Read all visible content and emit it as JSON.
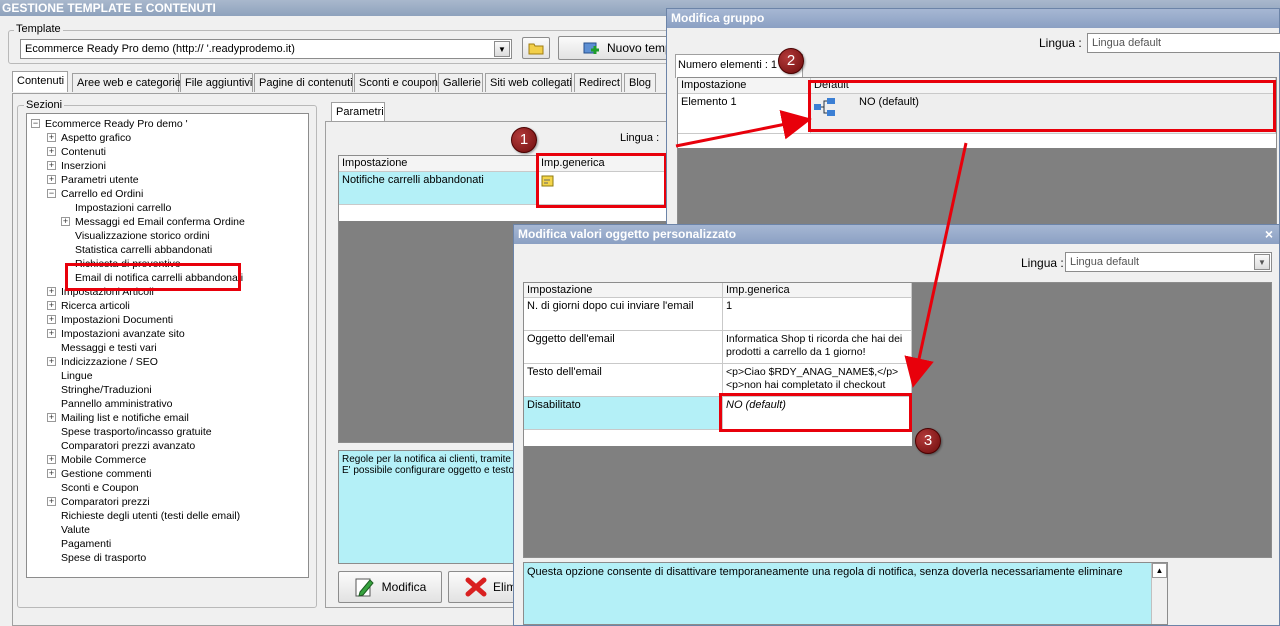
{
  "app": {
    "title": "GESTIONE TEMPLATE E CONTENUTI"
  },
  "template": {
    "legend": "Template",
    "selected": "Ecommerce Ready Pro demo        (http://         '.readyprodemo.it)",
    "new_button": "Nuovo temp"
  },
  "tabs": [
    "Contenuti",
    "Aree web e categorie",
    "File aggiuntivi",
    "Pagine di contenuti",
    "Sconti e coupon",
    "Gallerie",
    "Siti web collegati",
    "Redirect",
    "Blog"
  ],
  "sections": {
    "legend": "Sezioni",
    "root": "Ecommerce Ready Pro demo         '",
    "items": [
      {
        "label": "Aspetto grafico",
        "level": 1,
        "exp": "+"
      },
      {
        "label": "Contenuti",
        "level": 1,
        "exp": "+"
      },
      {
        "label": "Inserzioni",
        "level": 1,
        "exp": "+"
      },
      {
        "label": "Parametri utente",
        "level": 1,
        "exp": "+"
      },
      {
        "label": "Carrello ed Ordini",
        "level": 1,
        "exp": "-"
      },
      {
        "label": "Impostazioni carrello",
        "level": 2,
        "exp": ""
      },
      {
        "label": "Messaggi ed Email conferma Ordine",
        "level": 2,
        "exp": "+"
      },
      {
        "label": "Visualizzazione storico ordini",
        "level": 2,
        "exp": ""
      },
      {
        "label": "Statistica carrelli abbandonati",
        "level": 2,
        "exp": ""
      },
      {
        "label": "Richiesta di preventivo",
        "level": 2,
        "exp": ""
      },
      {
        "label": "Email di notifica carrelli abbandonati",
        "level": 2,
        "exp": ""
      },
      {
        "label": "Impostazioni Articoli",
        "level": 1,
        "exp": "+"
      },
      {
        "label": "Ricerca articoli",
        "level": 1,
        "exp": "+"
      },
      {
        "label": "Impostazioni Documenti",
        "level": 1,
        "exp": "+"
      },
      {
        "label": "Impostazioni avanzate sito",
        "level": 1,
        "exp": "+"
      },
      {
        "label": "Messaggi e testi vari",
        "level": 1,
        "exp": ""
      },
      {
        "label": "Indicizzazione / SEO",
        "level": 1,
        "exp": "+"
      },
      {
        "label": "Lingue",
        "level": 1,
        "exp": ""
      },
      {
        "label": "Stringhe/Traduzioni",
        "level": 1,
        "exp": ""
      },
      {
        "label": "Pannello amministrativo",
        "level": 1,
        "exp": ""
      },
      {
        "label": "Mailing list e notifiche email",
        "level": 1,
        "exp": "+"
      },
      {
        "label": "Spese trasporto/incasso gratuite",
        "level": 1,
        "exp": ""
      },
      {
        "label": "Comparatori prezzi avanzato",
        "level": 1,
        "exp": ""
      },
      {
        "label": "Mobile Commerce",
        "level": 1,
        "exp": "+"
      },
      {
        "label": "Gestione commenti",
        "level": 1,
        "exp": "+"
      },
      {
        "label": "Sconti e Coupon",
        "level": 1,
        "exp": ""
      },
      {
        "label": "Comparatori prezzi",
        "level": 1,
        "exp": "+"
      },
      {
        "label": "Richieste degli utenti (testi delle email)",
        "level": 1,
        "exp": ""
      },
      {
        "label": "Valute",
        "level": 1,
        "exp": ""
      },
      {
        "label": "Pagamenti",
        "level": 1,
        "exp": ""
      },
      {
        "label": "Spese di trasporto",
        "level": 1,
        "exp": ""
      }
    ]
  },
  "params": {
    "tab": "Parametri",
    "lingua_label": "Lingua :",
    "headers": [
      "Impostazione",
      "Imp.generica"
    ],
    "row": "Notifiche carrelli abbandonati",
    "description": "Regole per la notifica ai clienti, tramite e\nE' possibile configurare oggetto e testo",
    "modify_button": "Modifica",
    "delete_button": "Elim"
  },
  "group_window": {
    "title": "Modifica gruppo",
    "lingua_label": "Lingua :",
    "lingua_value": "Lingua default",
    "count": "Numero elementi : 1",
    "headers": [
      "Impostazione",
      "Default"
    ],
    "row_label": "Elemento 1",
    "row_value": "NO (default)"
  },
  "values_window": {
    "title": "Modifica valori oggetto personalizzato",
    "close": "×",
    "lingua_label": "Lingua :",
    "lingua_value": "Lingua default",
    "headers": [
      "Impostazione",
      "Imp.generica"
    ],
    "rows": [
      {
        "label": "N. di giorni dopo cui inviare l'email",
        "value": "1"
      },
      {
        "label": "Oggetto dell'email",
        "value": "Informatica Shop ti ricorda che hai dei prodotti a carrello da 1 giorno!"
      },
      {
        "label": "Testo dell'email",
        "value": "<p>Ciao $RDY_ANAG_NAME$,</p>\n<p>non hai completato il checkout"
      },
      {
        "label": "Disabilitato",
        "value": "NO (default)"
      }
    ],
    "description": "Questa opzione consente di disattivare temporaneamente una regola di notifica, senza doverla necessariamente eliminare"
  },
  "badges": [
    "1",
    "2",
    "3"
  ],
  "colors": {
    "highlight": "#e8000b",
    "cyan": "#b4f0f7",
    "grid_gray": "#808080"
  }
}
